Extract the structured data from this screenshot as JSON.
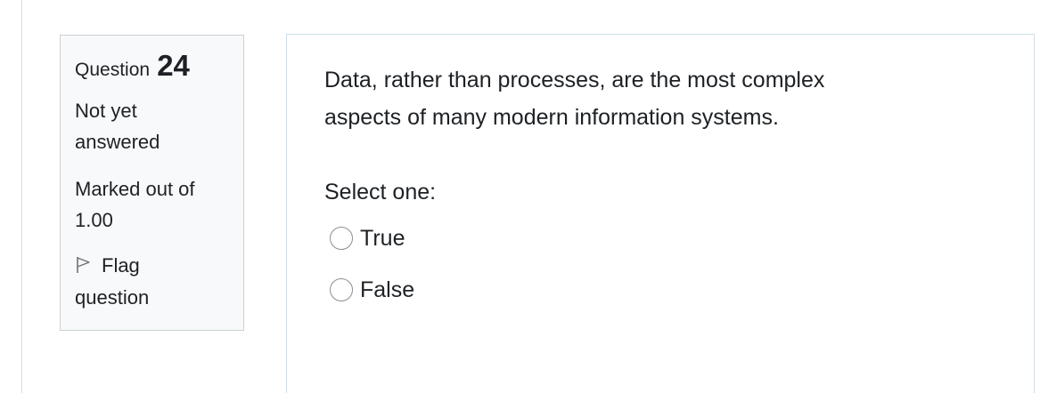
{
  "question_info": {
    "label": "Question",
    "number": "24",
    "state_line1": "Not yet",
    "state_line2": "answered",
    "grade_line1": "Marked out of",
    "grade_line2": "1.00",
    "flag_line1": "Flag",
    "flag_line2": "question",
    "flag_icon": "flag-outline-icon"
  },
  "question": {
    "text_line1": "Data, rather than processes, are the most complex",
    "text_line2": "aspects of many modern information systems.",
    "prompt": "Select one:",
    "options": [
      {
        "label": "True",
        "selected": false
      },
      {
        "label": "False",
        "selected": false
      }
    ]
  }
}
